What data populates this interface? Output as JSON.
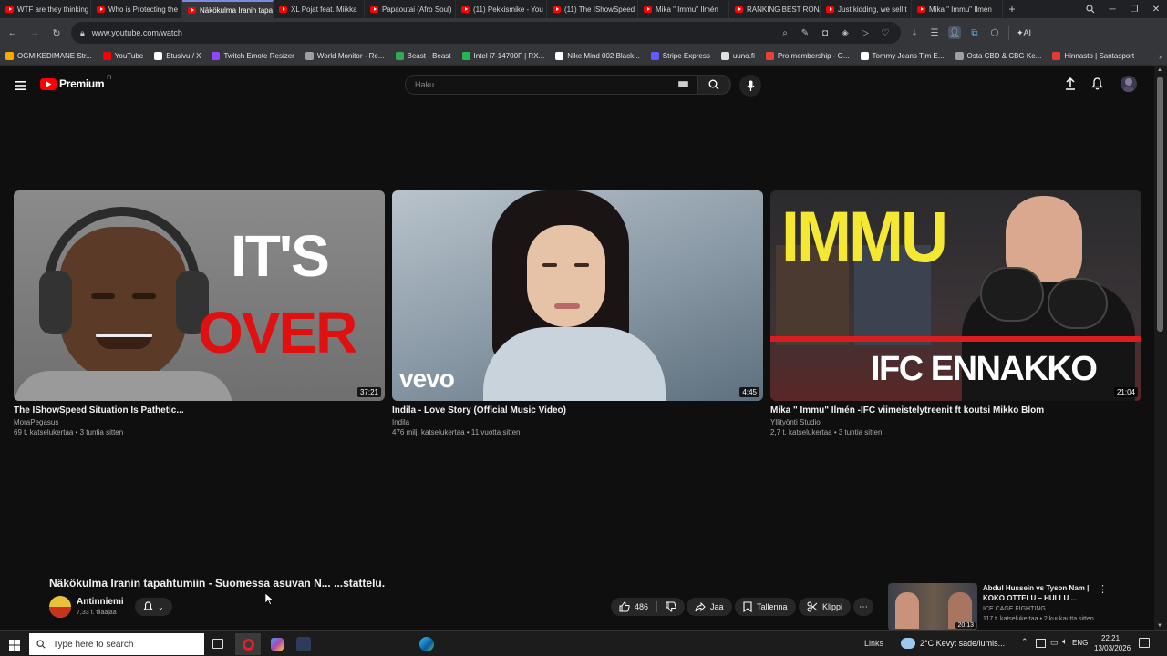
{
  "browser": {
    "tabs": [
      {
        "title": "WTF are they thinking",
        "active": false
      },
      {
        "title": "Who is Protecting the",
        "active": false
      },
      {
        "title": "Näkökulma Iranin tapaht",
        "active": true
      },
      {
        "title": "XL Pojat feat. Miikka",
        "active": false
      },
      {
        "title": "Papaoutai (Afro Soul)",
        "active": false
      },
      {
        "title": "(11) Pekkismike - You",
        "active": false
      },
      {
        "title": "(11) The IShowSpeed",
        "active": false
      },
      {
        "title": "Mika \" Immu\" Ilmén",
        "active": false
      },
      {
        "title": "RANKING BEST RONA",
        "active": false
      },
      {
        "title": "Just kidding, we sell t",
        "active": false
      },
      {
        "title": "Mika \" Immu\" Ilmén",
        "active": false
      }
    ],
    "url": "www.youtube.com/watch",
    "ai_label": "AI",
    "bookmarks": [
      {
        "label": "OGMIKEDIMANE Str...",
        "color": "#f9ab00"
      },
      {
        "label": "YouTube",
        "color": "#ff0000"
      },
      {
        "label": "Etusivu / X",
        "color": "#ffffff"
      },
      {
        "label": "Twitch Emote Resizer",
        "color": "#9146ff"
      },
      {
        "label": "World Monitor - Re...",
        "color": "#9aa0a6"
      },
      {
        "label": "Beast - Beast",
        "color": "#34a853"
      },
      {
        "label": "Intel i7-14700F | RX...",
        "color": "#1db954"
      },
      {
        "label": "Nike Mind 002 Black...",
        "color": "#ffffff"
      },
      {
        "label": "Stripe Express",
        "color": "#635bff"
      },
      {
        "label": "uuno.fi",
        "color": "#e0e0e0"
      },
      {
        "label": "Pro membership - G...",
        "color": "#ea4335"
      },
      {
        "label": "Tommy Jeans Tjm E...",
        "color": "#ffffff"
      },
      {
        "label": "Osta CBD & CBG Ke...",
        "color": "#9aa0a6"
      },
      {
        "label": "Hinnasto | Santasport",
        "color": "#e53935"
      }
    ]
  },
  "youtube": {
    "logo_text": "Premium",
    "logo_sup": "FI",
    "search_placeholder": "Haku"
  },
  "videos": [
    {
      "title": "The IShowSpeed Situation Is Pathetic...",
      "channel": "MoraPegasus",
      "meta": "69 t. katselukertaa • 3 tuntia sitten",
      "duration": "37:21",
      "thumb_text_1": "IT'S",
      "thumb_text_2": "OVER"
    },
    {
      "title": "Indila - Love Story (Official Music Video)",
      "channel": "Indila",
      "meta": "476 milj. katselukertaa • 11 vuotta sitten",
      "duration": "4:45",
      "thumb_text_1": "vevo"
    },
    {
      "title": "Mika \" Immu\" Ilmén -IFC viimeistelytreenit ft koutsi Mikko Blom",
      "channel": "Yllityönti Studio",
      "meta": "2,7 t. katselukertaa • 3 tuntia sitten",
      "duration": "21:04",
      "thumb_text_1": "IMMU",
      "thumb_text_2": "IFC ENNAKKO"
    }
  ],
  "current_video": {
    "title": "Näkökulma Iranin tapahtumiin - Suomessa asuvan N... ...stattelu.",
    "channel": "Antinniemi",
    "subscribers": "7,33 t. tilaajaa",
    "likes": "486",
    "share_label": "Jaa",
    "save_label": "Tallenna",
    "clip_label": "Klippi"
  },
  "miniplayer": {
    "title": "Abdul Hussein vs Tyson Nam | KOKO OTTELU – HULLU ...",
    "channel": "ICE CAGE FIGHTING",
    "meta": "117 t. katselukertaa • 2 kuukautta sitten",
    "duration": "20:13"
  },
  "taskbar": {
    "search_placeholder": "Type here to search",
    "links_label": "Links",
    "weather": "2°C  Kevyt sade/lumis...",
    "lang": "ENG",
    "time": "22.21",
    "date": "13/03/2026"
  }
}
